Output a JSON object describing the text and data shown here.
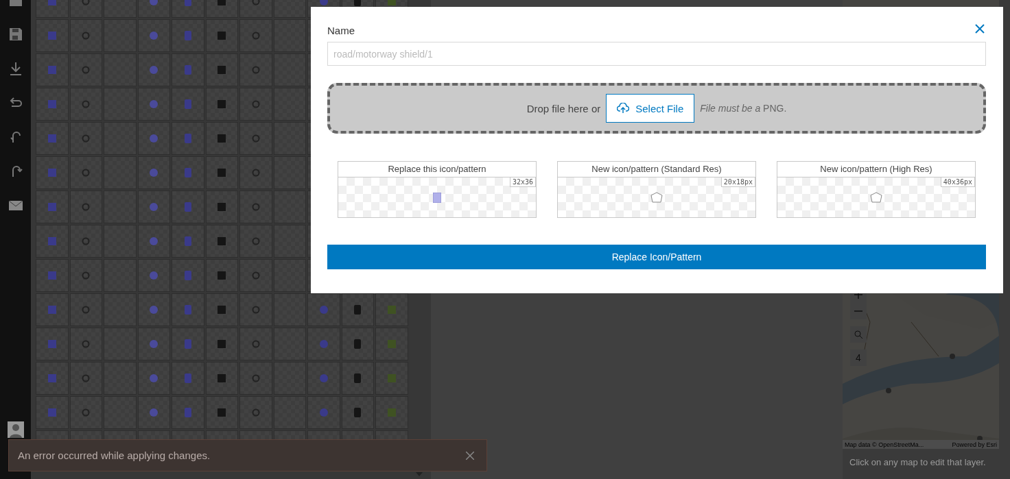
{
  "modal": {
    "name_label": "Name",
    "name_field": {
      "placeholder": "road/motorway shield/1"
    },
    "dropzone": {
      "prompt": "Drop file here or",
      "button": "Select File",
      "hint": "*File must be a* PNG."
    },
    "previews": [
      {
        "title": "Replace this icon/pattern",
        "size": "32x36",
        "kind": "current"
      },
      {
        "title": "New icon/pattern (Standard Res)",
        "size": "20x18px",
        "kind": "placeholder"
      },
      {
        "title": "New icon/pattern (High Res)",
        "size": "40x36px",
        "kind": "placeholder"
      }
    ],
    "submit_button": "Replace Icon/Pattern"
  },
  "map_panel": {
    "zoom_level": "4",
    "attribution": "Map data © OpenStreetMa...",
    "powered_by": "Powered by Esri",
    "hint": "Click on any map to edit that layer."
  },
  "toast": {
    "message": "An error occurred while applying changes."
  }
}
